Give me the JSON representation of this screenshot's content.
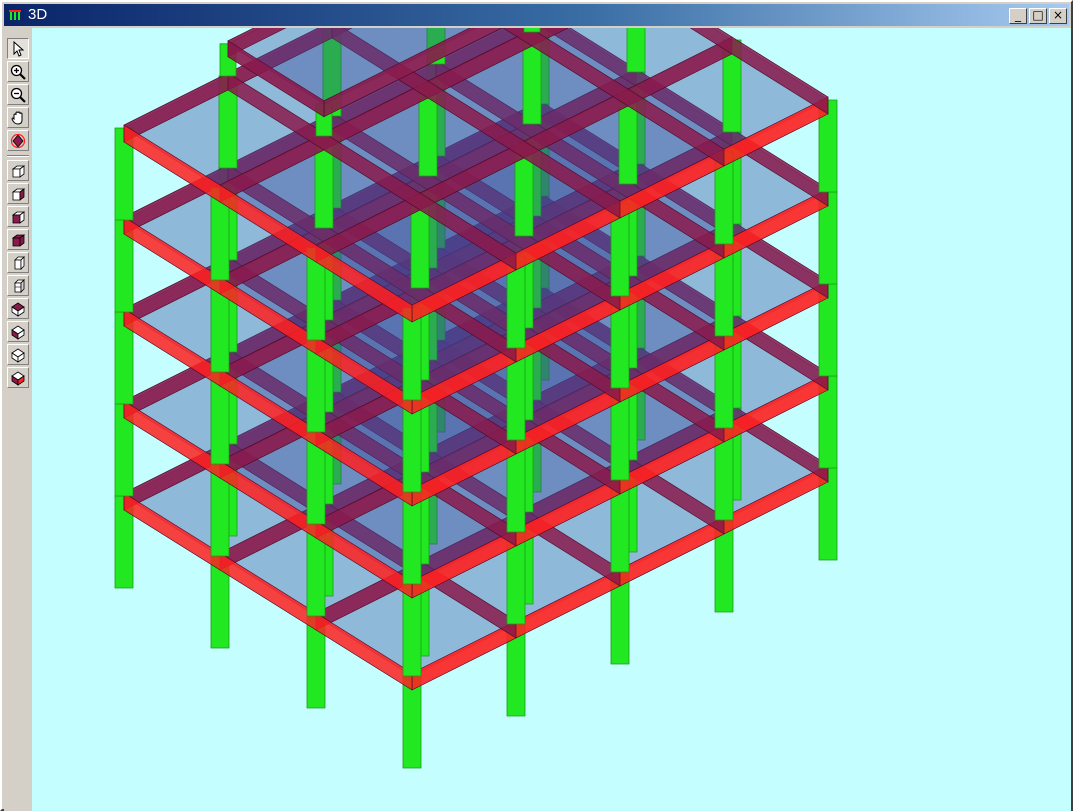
{
  "window": {
    "title": "3D",
    "minimize_glyph": "_",
    "maximize_glyph": "□",
    "close_glyph": "×"
  },
  "toolbar": {
    "tools": [
      {
        "name": "select-tool",
        "icon": "cursor-arrow-icon"
      },
      {
        "name": "zoom-in-tool",
        "icon": "zoom-in-icon"
      },
      {
        "name": "zoom-out-tool",
        "icon": "zoom-out-icon"
      },
      {
        "name": "pan-tool",
        "icon": "hand-icon"
      },
      {
        "name": "rotate-tool",
        "icon": "rotate-icon"
      },
      {
        "name": "view-iso-1",
        "icon": "cube-iso-1-icon"
      },
      {
        "name": "view-iso-2",
        "icon": "cube-iso-2-icon"
      },
      {
        "name": "view-iso-3",
        "icon": "cube-iso-3-icon"
      },
      {
        "name": "view-iso-4",
        "icon": "cube-iso-4-icon"
      },
      {
        "name": "view-front",
        "icon": "cube-front-icon"
      },
      {
        "name": "view-side",
        "icon": "cube-side-icon"
      },
      {
        "name": "view-top",
        "icon": "cube-top-icon"
      },
      {
        "name": "view-bottom",
        "icon": "cube-bottom-icon"
      },
      {
        "name": "view-back",
        "icon": "cube-back-icon"
      },
      {
        "name": "view-render",
        "icon": "cube-render-icon"
      }
    ]
  },
  "colors": {
    "background": "#c4fefe",
    "column": "#22e822",
    "beam": "#8a1a4c",
    "beam_highlight": "#ff2020",
    "slab": "#3a4a9a"
  },
  "model": {
    "floors": 5,
    "description_visible": false
  }
}
